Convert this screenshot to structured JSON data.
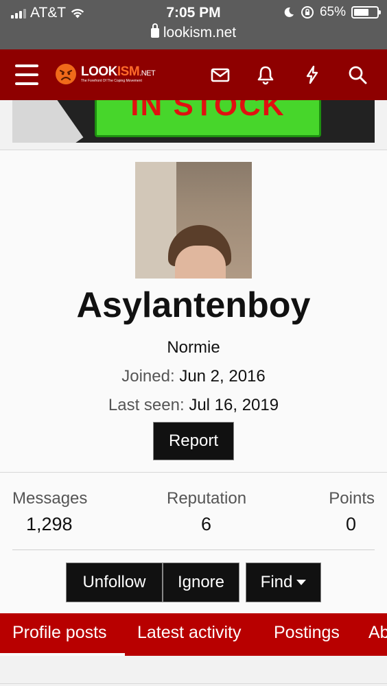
{
  "status_bar": {
    "carrier": "AT&T",
    "time": "7:05 PM",
    "battery_percent": "65%",
    "battery_level": 0.65,
    "url": "lookism.net"
  },
  "header": {
    "logo_part1": "LOOK",
    "logo_part2": "ISM",
    "logo_part3": ".NET",
    "logo_tagline": "The Forefront Of The Coping Movement",
    "icons": [
      "menu-icon",
      "envelope-icon",
      "bell-icon",
      "lightning-icon",
      "search-icon"
    ]
  },
  "banner": {
    "text": "IN STOCK"
  },
  "profile": {
    "username": "Asylantenboy",
    "user_title": "Normie",
    "joined_label": "Joined:",
    "joined_value": "Jun 2, 2016",
    "last_seen_label": "Last seen:",
    "last_seen_value": "Jul 16, 2019",
    "report_button": "Report"
  },
  "stats": {
    "messages_label": "Messages",
    "messages_value": "1,298",
    "reputation_label": "Reputation",
    "reputation_value": "6",
    "points_label": "Points",
    "points_value": "0"
  },
  "actions": {
    "unfollow": "Unfollow",
    "ignore": "Ignore",
    "find": "Find"
  },
  "tabs": [
    {
      "label": "Profile posts"
    },
    {
      "label": "Latest activity"
    },
    {
      "label": "Postings"
    },
    {
      "label": "Ab"
    }
  ],
  "colors": {
    "header_bg": "#8e0000",
    "tabs_bg": "#b80000",
    "button_bg": "#111111"
  }
}
